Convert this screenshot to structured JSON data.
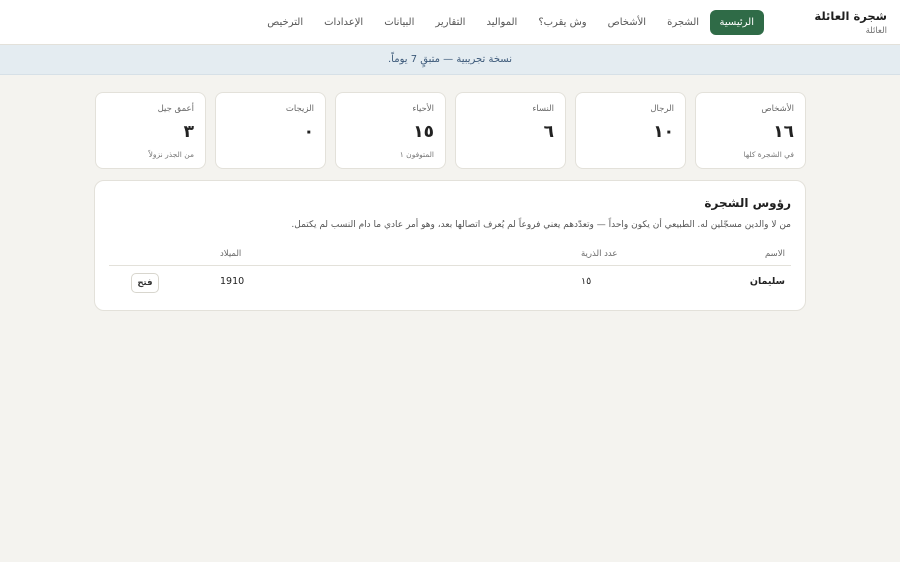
{
  "app": {
    "title": "شجرة العائلة",
    "subtitle": "العائلة"
  },
  "nav": [
    {
      "label": "الرئيسية",
      "active": true
    },
    {
      "label": "الشجرة",
      "active": false
    },
    {
      "label": "الأشخاص",
      "active": false
    },
    {
      "label": "وش يقرب؟",
      "active": false
    },
    {
      "label": "المواليد",
      "active": false
    },
    {
      "label": "التقارير",
      "active": false
    },
    {
      "label": "البيانات",
      "active": false
    },
    {
      "label": "الإعدادات",
      "active": false
    },
    {
      "label": "الترخيص",
      "active": false
    }
  ],
  "banner": {
    "text": "نسخة تجريبية — متبقٍ 7 يوماً."
  },
  "stats": [
    {
      "label": "الأشخاص",
      "value": "١٦",
      "note": "في الشجرة كلها"
    },
    {
      "label": "الرجال",
      "value": "١٠",
      "note": ""
    },
    {
      "label": "النساء",
      "value": "٦",
      "note": ""
    },
    {
      "label": "الأحياء",
      "value": "١٥",
      "note": "المتوفون ١"
    },
    {
      "label": "الزيجات",
      "value": "٠",
      "note": ""
    },
    {
      "label": "أعمق جيل",
      "value": "٣",
      "note": "من الجذر نزولاً"
    }
  ],
  "roots": {
    "title": "رؤوس الشجرة",
    "description": "من لا والدين مسجّلين له. الطبيعي أن يكون واحداً — وتعدّدهم يعني فروعاً لم يُعرف اتصالها بعد، وهو أمر عادي ما دام النسب لم يكتمل.",
    "columns": {
      "name": "الاسم",
      "descendants": "عدد الذرية",
      "birth": "الميلاد"
    },
    "rows": [
      {
        "name": "سليمان",
        "descendants": "١٥",
        "birth": "1910",
        "action": "فتح"
      }
    ]
  },
  "colors": {
    "accent": "#2f6b47",
    "banner_bg": "#e4ecf1",
    "banner_text": "#3d5a7a",
    "page_bg": "#f4f3ef"
  }
}
